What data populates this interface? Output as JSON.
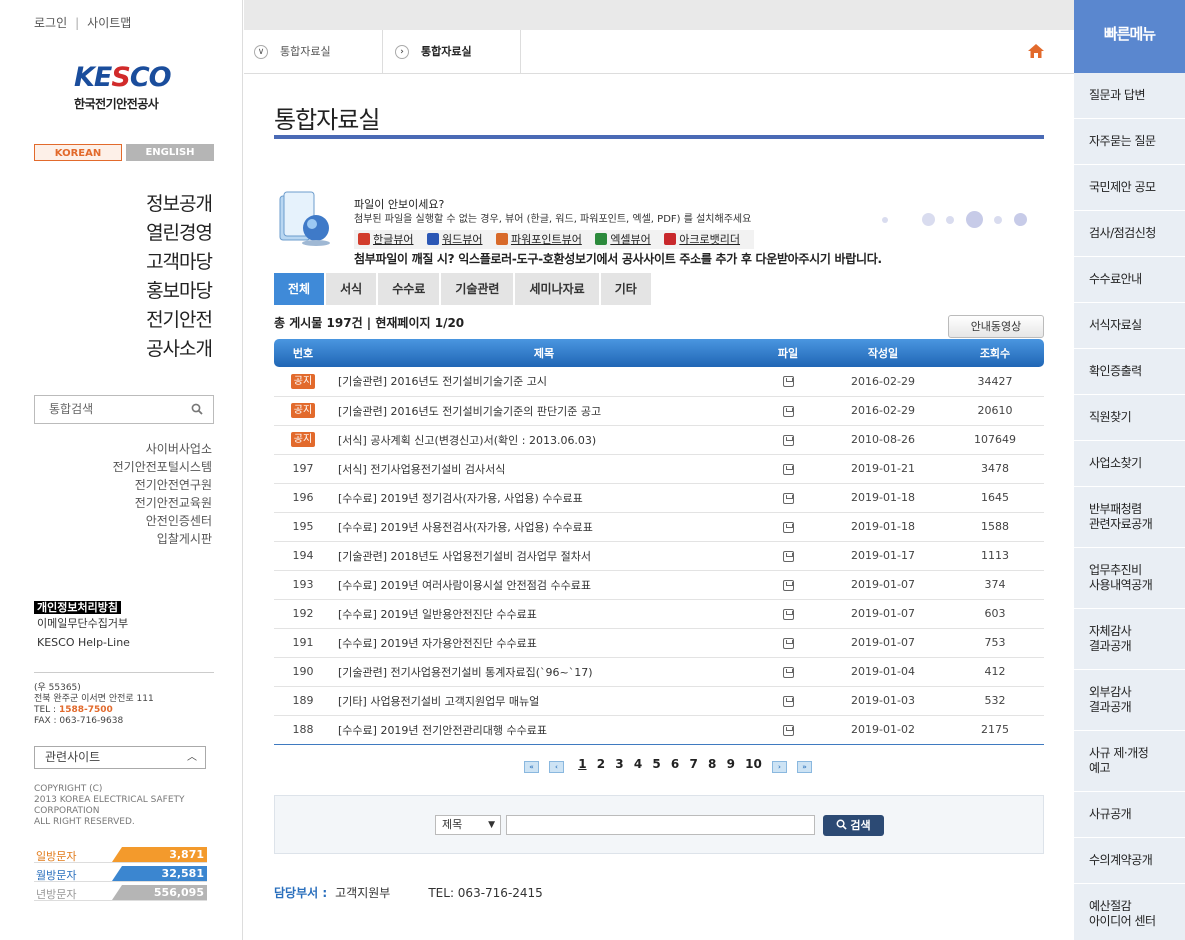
{
  "top_links": [
    "로그인",
    "사이트맵"
  ],
  "logo": {
    "mark_a": "KE",
    "mark_b": "S",
    "mark_c": "CO",
    "sub": "한국전기안전공사"
  },
  "lang": {
    "korean": "KOREAN",
    "english": "ENGLISH"
  },
  "main_menu": [
    "정보공개",
    "열린경영",
    "고객마당",
    "홍보마당",
    "전기안전",
    "공사소개"
  ],
  "left_search": {
    "placeholder": "통합검색"
  },
  "site_links": [
    "사이버사업소",
    "전기안전포털시스템",
    "전기안전연구원",
    "전기안전교육원",
    "안전인증센터",
    "입찰게시판"
  ],
  "privacy": {
    "title": "개인정보처리방침",
    "links": [
      "이메일무단수집거부",
      "KESCO Help-Line"
    ]
  },
  "address": {
    "zip": "(우 55365)",
    "addr": "전북 완주군 이서면 안전로 111",
    "tel_label": "TEL : ",
    "tel": "1588-7500",
    "fax": "FAX : 063-716-9638"
  },
  "related_site": "관련사이트",
  "copyright": [
    "COPYRIGHT (C)",
    "2013 KOREA ELECTRICAL SAFETY",
    "CORPORATION",
    "ALL RIGHT RESERVED."
  ],
  "visitor_stats": [
    {
      "label": "일방문자",
      "value": "3,871"
    },
    {
      "label": "월방문자",
      "value": "32,581"
    },
    {
      "label": "년방문자",
      "value": "556,095"
    }
  ],
  "breadcrumb": [
    "통합자료실",
    "통합자료실"
  ],
  "page_title": "통합자료실",
  "viewer": {
    "question": "파일이 안보이세요?",
    "desc": "첨부된 파일을 실행할 수 없는 경우, 뷰어 (한글, 워드, 파워포인트, 엑셀, PDF) 를 설치해주세요",
    "links": [
      {
        "label": "한글뷰어",
        "color": "#d23c2c"
      },
      {
        "label": "워드뷰어",
        "color": "#2b57b5"
      },
      {
        "label": "파워포인트뷰어",
        "color": "#d86a2a"
      },
      {
        "label": "엑셀뷰어",
        "color": "#2c8a3c"
      },
      {
        "label": "아크로뱃리더",
        "color": "#c8282c"
      }
    ],
    "warning": "첨부파일이 깨질 시? 익스플로러-도구-호환성보기에서 공사사이트 주소를 추가 후 다운받아주시기 바랍니다."
  },
  "tabs": [
    "전체",
    "서식",
    "수수료",
    "기술관련",
    "세미나자료",
    "기타"
  ],
  "summary": "총 게시물 197건  |  현재페이지 1/20",
  "guide_button": "안내동영상",
  "table": {
    "headers": [
      "번호",
      "제목",
      "파일",
      "작성일",
      "조회수"
    ],
    "rows": [
      {
        "no": "공지",
        "notice": true,
        "title": "[기술관련] 2016년도 전기설비기술기준 고시",
        "date": "2016-02-29",
        "views": "34427"
      },
      {
        "no": "공지",
        "notice": true,
        "title": "[기술관련] 2016년도 전기설비기술기준의 판단기준 공고",
        "date": "2016-02-29",
        "views": "20610"
      },
      {
        "no": "공지",
        "notice": true,
        "title": "[서식] 공사계획 신고(변경신고)서(확인 : 2013.06.03)",
        "date": "2010-08-26",
        "views": "107649"
      },
      {
        "no": "197",
        "notice": false,
        "title": "[서식] 전기사업용전기설비 검사서식",
        "date": "2019-01-21",
        "views": "3478"
      },
      {
        "no": "196",
        "notice": false,
        "title": "[수수료] 2019년 정기검사(자가용, 사업용) 수수료표",
        "date": "2019-01-18",
        "views": "1645"
      },
      {
        "no": "195",
        "notice": false,
        "title": "[수수료] 2019년 사용전검사(자가용, 사업용) 수수료표",
        "date": "2019-01-18",
        "views": "1588"
      },
      {
        "no": "194",
        "notice": false,
        "title": "[기술관련] 2018년도 사업용전기설비 검사업무 절차서",
        "date": "2019-01-17",
        "views": "1113"
      },
      {
        "no": "193",
        "notice": false,
        "title": "[수수료] 2019년 여러사람이용시설 안전점검 수수료표",
        "date": "2019-01-07",
        "views": "374"
      },
      {
        "no": "192",
        "notice": false,
        "title": "[수수료] 2019년 일반용안전진단 수수료표",
        "date": "2019-01-07",
        "views": "603"
      },
      {
        "no": "191",
        "notice": false,
        "title": "[수수료] 2019년 자가용안전진단 수수료표",
        "date": "2019-01-07",
        "views": "753"
      },
      {
        "no": "190",
        "notice": false,
        "title": "[기술관련] 전기사업용전기설비 통계자료집(`96~`17)",
        "date": "2019-01-04",
        "views": "412"
      },
      {
        "no": "189",
        "notice": false,
        "title": "[기타] 사업용전기설비 고객지원업무 매뉴얼",
        "date": "2019-01-03",
        "views": "532"
      },
      {
        "no": "188",
        "notice": false,
        "title": "[수수료] 2019년 전기안전관리대행 수수료표",
        "date": "2019-01-02",
        "views": "2175"
      }
    ]
  },
  "pagination": {
    "pages": [
      "1",
      "2",
      "3",
      "4",
      "5",
      "6",
      "7",
      "8",
      "9",
      "10"
    ],
    "current": "1"
  },
  "search": {
    "field": "제목",
    "button": "검색",
    "value": ""
  },
  "contact": {
    "label": "담당부서 :",
    "dept": "고객지원부",
    "tel": "TEL: 063-716-2415"
  },
  "quick_menu": {
    "title": "빠른메뉴",
    "items": [
      "질문과 답변",
      "자주묻는 질문",
      "국민제안 공모",
      "검사/점검신청",
      "수수료안내",
      "서식자료실",
      "확인증출력",
      "직원찾기",
      "사업소찾기",
      "반부패청렴\n관련자료공개",
      "업무추진비\n사용내역공개",
      "자체감사\n결과공개",
      "외부감사\n결과공개",
      "사규 제·개정\n예고",
      "사규공개",
      "수의계약공개",
      "예산절감\n아이디어 센터"
    ]
  },
  "colors": {
    "accent": "#3f8ad8",
    "brand": "#1a4d9c",
    "orange": "#e26a2c",
    "quick": "#5a87cf"
  }
}
